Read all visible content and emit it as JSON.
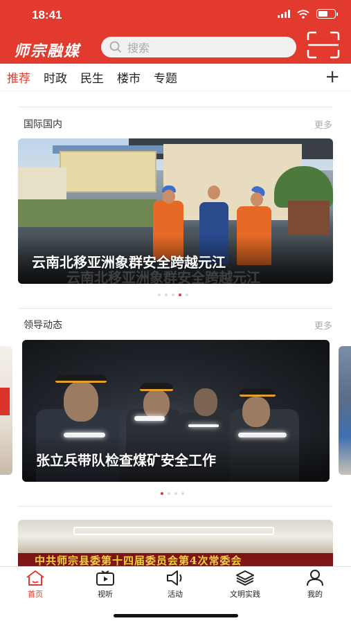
{
  "status_bar": {
    "time": "18:41",
    "battery_level": 0.6
  },
  "header": {
    "logo_text": "师宗融媒",
    "search_placeholder": "搜索",
    "brand_color": "#e23a2e"
  },
  "tabs": [
    {
      "label": "推荐",
      "active": true
    },
    {
      "label": "时政",
      "active": false
    },
    {
      "label": "民生",
      "active": false
    },
    {
      "label": "楼市",
      "active": false
    },
    {
      "label": "专题",
      "active": false
    }
  ],
  "tabs_add_label": "+",
  "sections": [
    {
      "title": "国际国内",
      "more_label": "更多",
      "slide_caption": "云南北移亚洲象群安全跨越元江",
      "pager": {
        "count": 5,
        "active_index": 3
      }
    },
    {
      "title": "领导动态",
      "more_label": "更多",
      "slide_caption": "张立兵带队检查煤矿安全工作",
      "pager": {
        "count": 4,
        "active_index": 0
      }
    },
    {
      "banner_text": "中共师宗县委第十四届委员会第4次常委会"
    }
  ],
  "bottom_nav": [
    {
      "label": "首页",
      "icon": "home-icon",
      "active": true
    },
    {
      "label": "视听",
      "icon": "video-icon",
      "active": false
    },
    {
      "label": "活动",
      "icon": "megaphone-icon",
      "active": false
    },
    {
      "label": "文明实践",
      "icon": "layers-icon",
      "active": false
    },
    {
      "label": "我的",
      "icon": "person-icon",
      "active": false
    }
  ]
}
